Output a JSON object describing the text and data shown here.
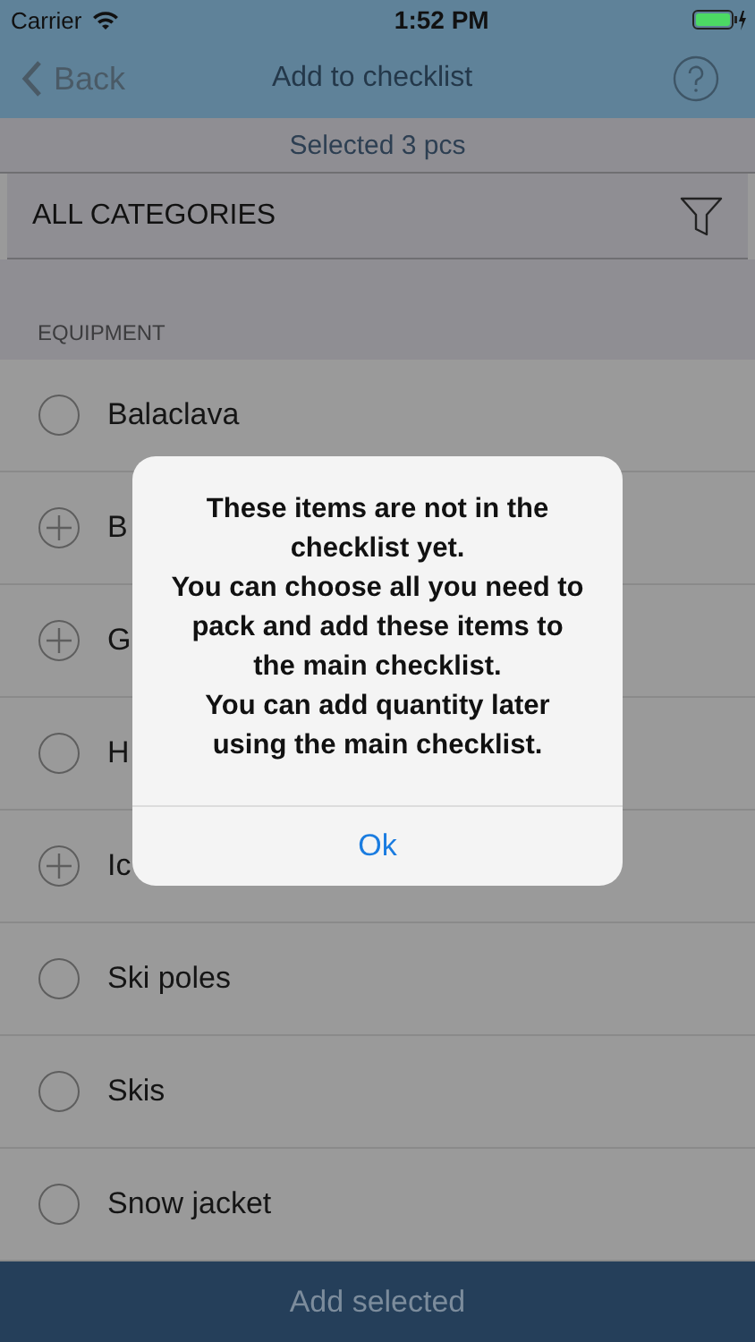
{
  "status_bar": {
    "carrier": "Carrier",
    "time": "1:52 PM"
  },
  "nav": {
    "back": "Back",
    "title": "Add to checklist"
  },
  "selection_summary": "Selected 3 pcs",
  "category_filter": "ALL CATEGORIES",
  "section": "EQUIPMENT",
  "items": [
    {
      "label": "Balaclava",
      "kind": "radio"
    },
    {
      "label": "B",
      "kind": "add"
    },
    {
      "label": "G",
      "kind": "add"
    },
    {
      "label": "H",
      "kind": "radio"
    },
    {
      "label": "Ic",
      "kind": "add"
    },
    {
      "label": "Ski poles",
      "kind": "radio"
    },
    {
      "label": "Skis",
      "kind": "radio"
    },
    {
      "label": "Snow jacket",
      "kind": "radio"
    }
  ],
  "alert": {
    "message": "These items are not in the checklist yet.\nYou can choose all you need to pack and add these items to the main checklist.\nYou can add quantity later using the main checklist.",
    "button": "Ok"
  },
  "bottom_button": "Add selected"
}
